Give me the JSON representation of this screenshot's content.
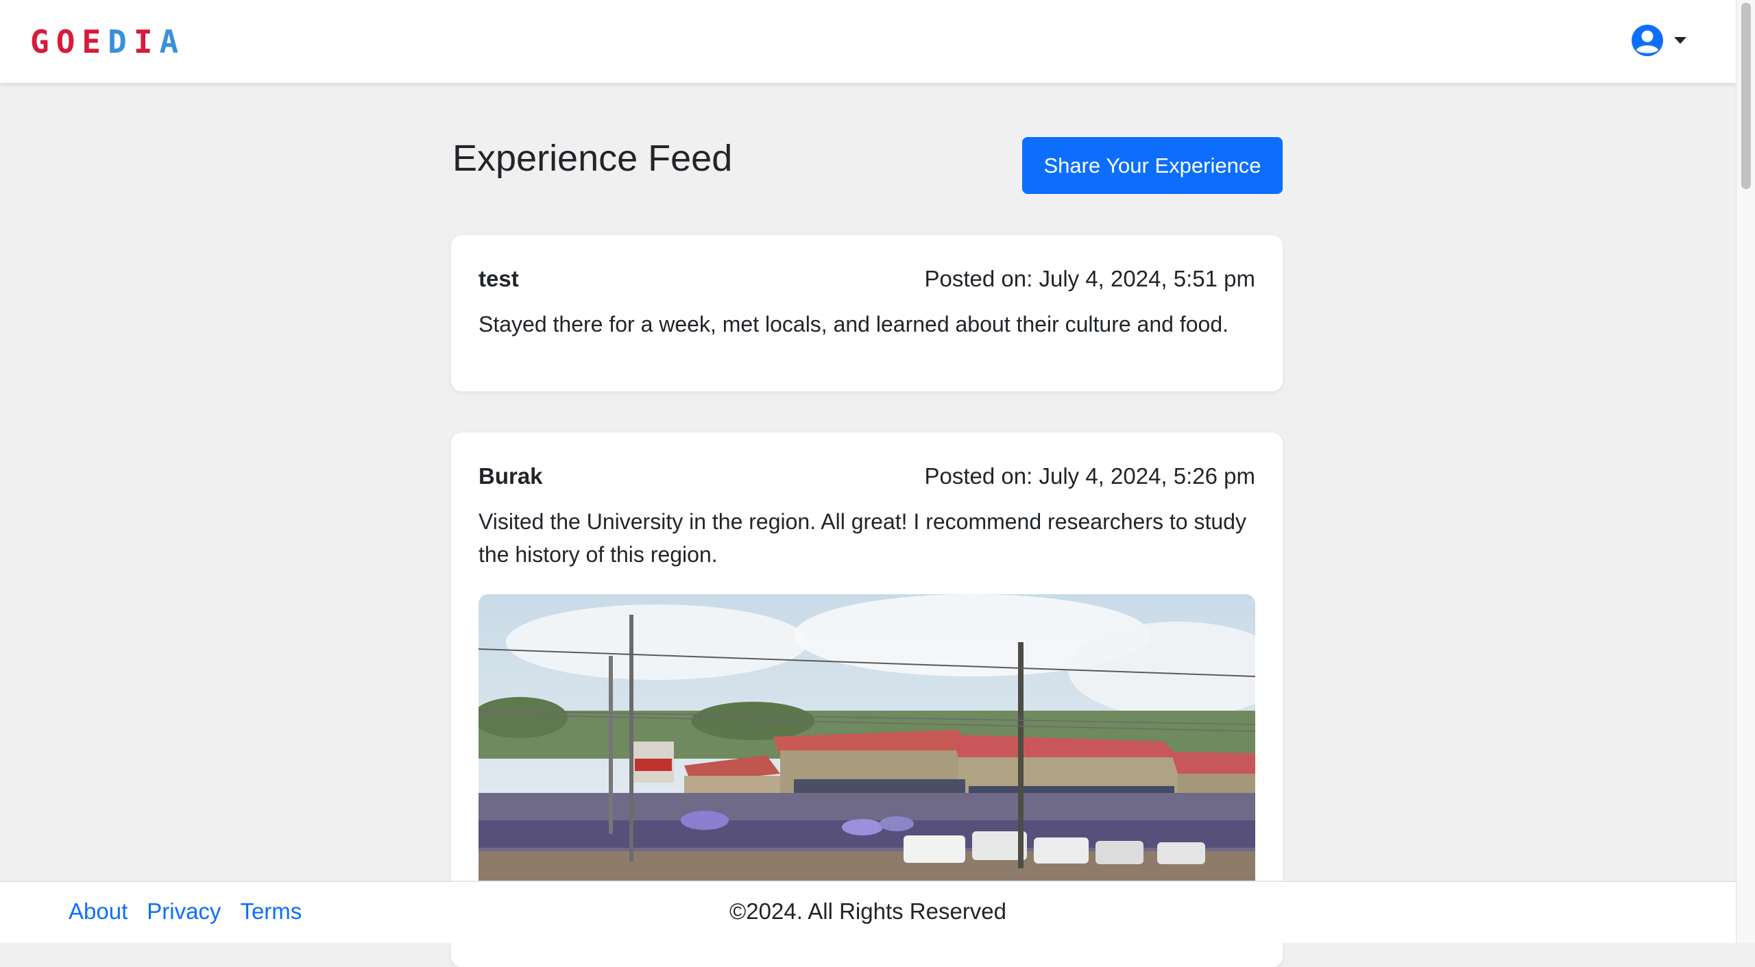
{
  "header": {
    "logo_text": "GOEDIA",
    "user_icon": "user-circle-icon",
    "dropdown_icon": "caret-down-icon"
  },
  "main": {
    "title": "Experience Feed",
    "share_button_label": "Share Your Experience"
  },
  "posts": [
    {
      "author": "test",
      "posted": "Posted on: July 4, 2024, 5:51 pm",
      "text": "Stayed there for a week, met locals, and learned about their culture and food."
    },
    {
      "author": "Burak",
      "posted": "Posted on: July 4, 2024, 5:26 pm",
      "text": "Visited the University in the region. All great! I recommend researchers to study the history of this region."
    }
  ],
  "footer": {
    "links": [
      "About",
      "Privacy",
      "Terms"
    ],
    "copyright": "©2024. All Rights Reserved"
  },
  "colors": {
    "primary": "#0d6efd",
    "logo_red": "#d81b3a",
    "logo_blue": "#3a8fde",
    "background": "#f0f0f0"
  }
}
